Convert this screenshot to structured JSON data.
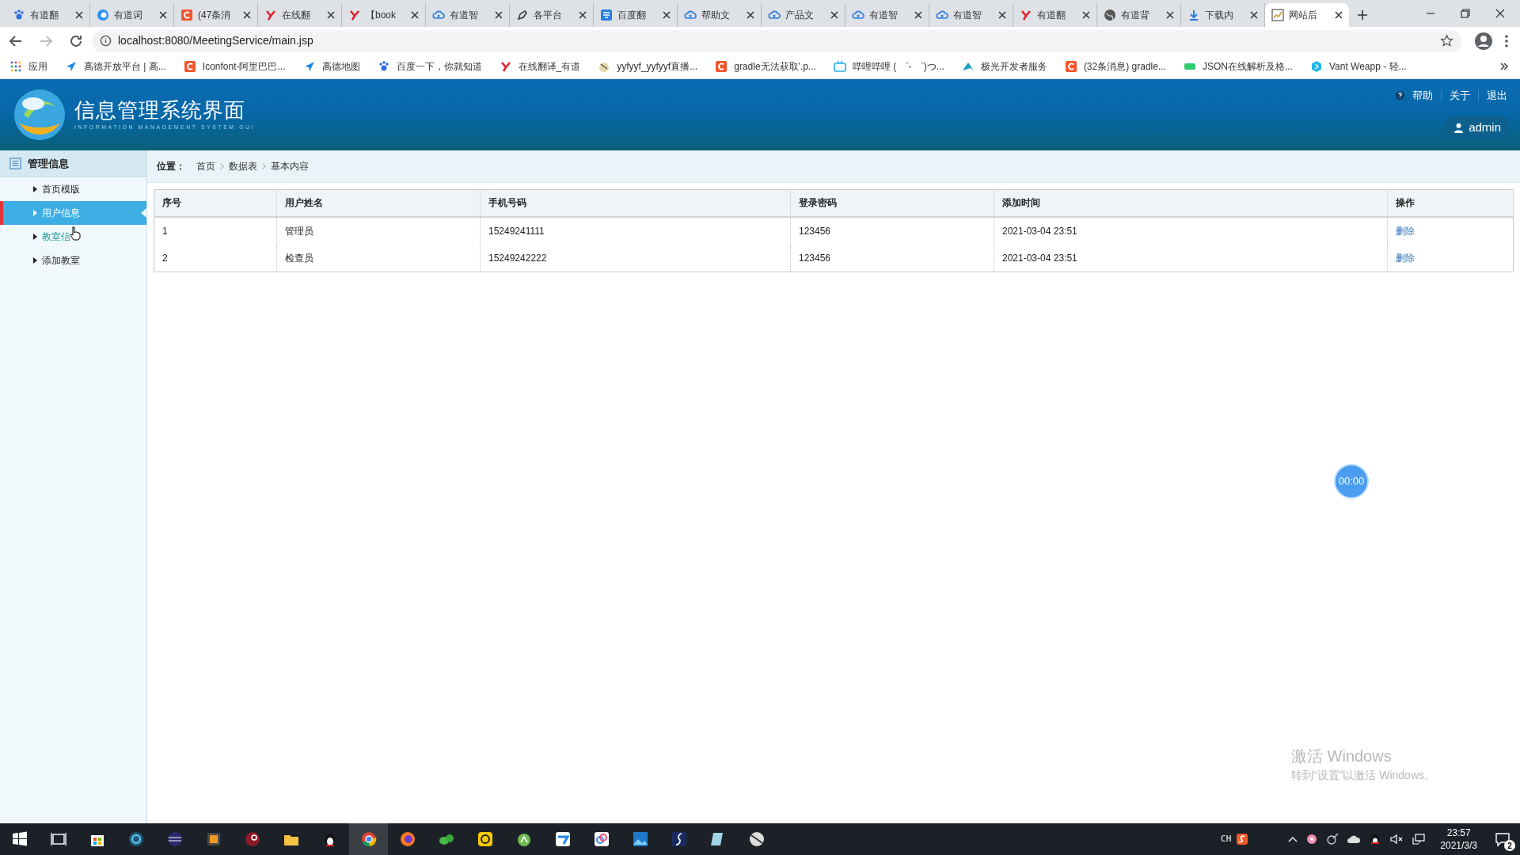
{
  "browser": {
    "tabs": [
      {
        "title": "有道翻",
        "selected": false
      },
      {
        "title": "有道词",
        "selected": false
      },
      {
        "title": "(47条消",
        "selected": false
      },
      {
        "title": "在线翻",
        "selected": false
      },
      {
        "title": "【book",
        "selected": false
      },
      {
        "title": "有道智",
        "selected": false
      },
      {
        "title": "各平台",
        "selected": false
      },
      {
        "title": "百度翻",
        "selected": false
      },
      {
        "title": "帮助文",
        "selected": false
      },
      {
        "title": "产品文",
        "selected": false
      },
      {
        "title": "有道智",
        "selected": false
      },
      {
        "title": "有道智",
        "selected": false
      },
      {
        "title": "有道翻",
        "selected": false
      },
      {
        "title": "有道背",
        "selected": false
      },
      {
        "title": "下载内",
        "selected": false
      },
      {
        "title": "网站后",
        "selected": true
      }
    ],
    "address": "localhost:8080/MeetingService/main.jsp",
    "bookmarks": [
      "应用",
      "高德开放平台 | 高...",
      "Iconfont-阿里巴巴...",
      "高德地图",
      "百度一下，你就知道",
      "在线翻译_有道",
      "yyfyyf_yyfyyf直播...",
      "gradle无法获取'.p...",
      "哔哩哔哩 ( ゜- ゜)つ...",
      "极光开发者服务",
      "(32条消息) gradle...",
      "JSON在线解析及格...",
      "Vant Weapp - 轻..."
    ]
  },
  "app": {
    "title": "信息管理系统界面",
    "subtitle": "INFORMATION MANAGEMENT SYSTEM GUI",
    "header_links": [
      "帮助",
      "关于",
      "退出"
    ],
    "user": "admin",
    "sidebar": {
      "title": "管理信息",
      "items": [
        {
          "label": "首页模版",
          "selected": false,
          "hovered": false
        },
        {
          "label": "用户信息",
          "selected": true,
          "hovered": false
        },
        {
          "label": "教室信",
          "selected": false,
          "hovered": true
        },
        {
          "label": "添加教室",
          "selected": false,
          "hovered": false
        }
      ]
    },
    "breadcrumb": {
      "label": "位置：",
      "path": [
        "首页",
        "数据表",
        "基本内容"
      ]
    },
    "table": {
      "columns": [
        "序号",
        "用户姓名",
        "手机号码",
        "登录密码",
        "添加时间",
        "操作"
      ],
      "rows": [
        {
          "cells": [
            "1",
            "管理员",
            "15249241111",
            "123456",
            "2021-03-04 23:51"
          ],
          "action": "删除"
        },
        {
          "cells": [
            "2",
            "检查员",
            "15249242222",
            "123456",
            "2021-03-04 23:51"
          ],
          "action": "删除"
        }
      ]
    },
    "timer": "00:00"
  },
  "activation_notice": {
    "title": "激活 Windows",
    "hint": "转到“设置”以激活 Windows。"
  },
  "taskbar": {
    "input_language": "CH",
    "time": "23:57",
    "date": "2021/3/3",
    "notifications": "2"
  }
}
